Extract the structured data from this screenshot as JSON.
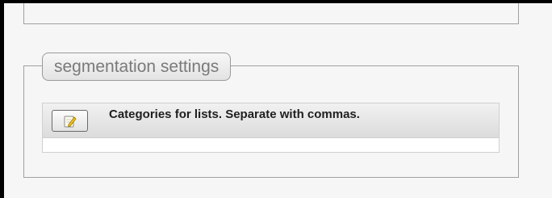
{
  "segmentation": {
    "legend": "segmentation settings",
    "row_label": "Categories for lists. Separate with commas.",
    "edit_icon": "edit-icon"
  },
  "colors": {
    "border": "#a0a0a0",
    "legend_text": "#7a7a7a",
    "label_text": "#1f1f1f",
    "icon_accent": "#f0c020"
  }
}
